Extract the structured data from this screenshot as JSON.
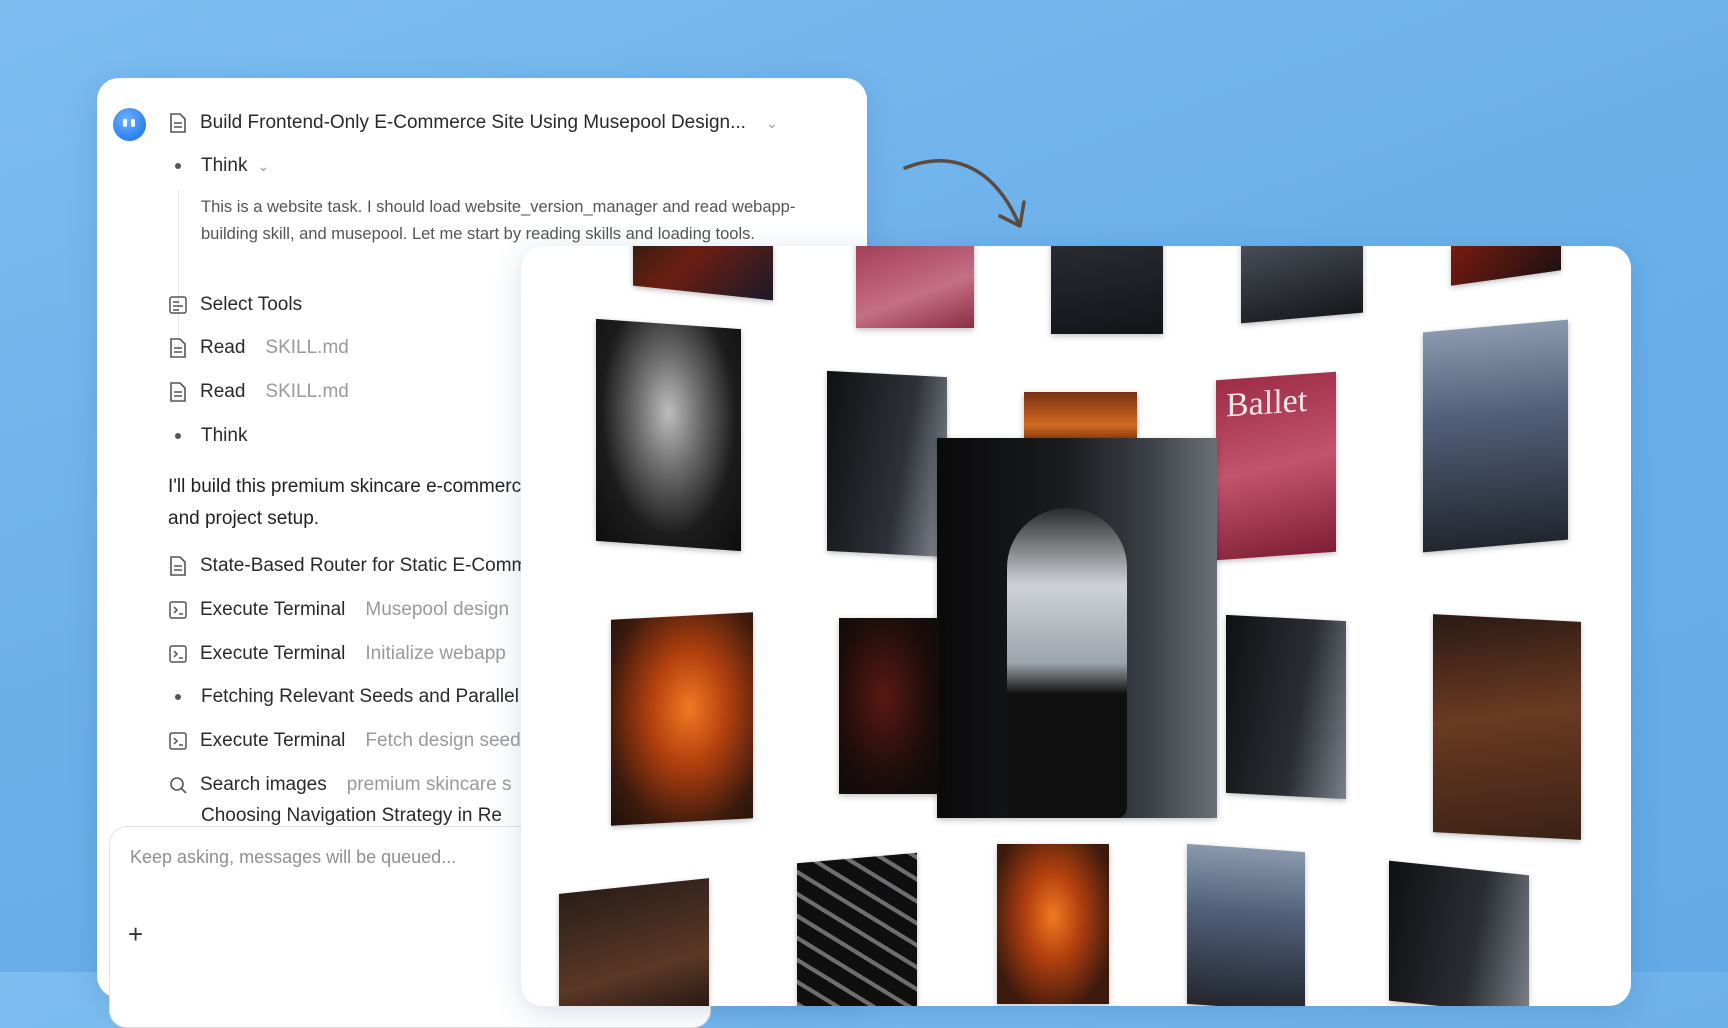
{
  "task": {
    "title": "Build Frontend-Only E-Commerce Site Using Musepool Design...",
    "think_label": "Think",
    "think_text": "This is a website task. I should load website_version_manager and read webapp-building skill, and musepool. Let me start by reading skills and loading tools.",
    "steps": [
      {
        "label": "Select Tools",
        "detail": ""
      },
      {
        "label": "Read",
        "detail": "SKILL.md"
      },
      {
        "label": "Read",
        "detail": "SKILL.md"
      },
      {
        "label": "Think",
        "detail": ""
      }
    ],
    "message": "I'll build this premium skincare e-commerce site. Let me start with design research and project setup.",
    "actions": [
      {
        "label": "State-Based Router for Static E-Commerce",
        "detail": ""
      },
      {
        "label": "Execute Terminal",
        "detail": "Musepool design"
      },
      {
        "label": "Execute Terminal",
        "detail": "Initialize webapp"
      },
      {
        "label": "Fetching Relevant Seeds and Parallel",
        "detail": ""
      },
      {
        "label": "Execute Terminal",
        "detail": "Fetch design seeds"
      },
      {
        "label": "Search images",
        "detail": "premium skincare s"
      },
      {
        "label": "Choosing Navigation Strategy in Re",
        "detail": ""
      }
    ]
  },
  "input": {
    "placeholder": "Keep asking, messages will be queued...",
    "add_label": "+"
  },
  "gallery": {
    "ballet_cover_title": "Ballet",
    "colors": {
      "warm": "#d1601a",
      "dark": "#1a1a1a",
      "pink": "#a4344c",
      "city": "#52607a"
    }
  }
}
